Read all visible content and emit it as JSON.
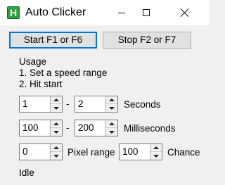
{
  "window": {
    "title": "Auto Clicker",
    "icon_letter": "H"
  },
  "buttons": {
    "start": "Start F1 or F6",
    "stop": "Stop F2 or F7"
  },
  "usage": {
    "heading": "Usage",
    "step1": "1. Set a speed range",
    "step2": "2. Hit start"
  },
  "seconds": {
    "min": "1",
    "separator": "-",
    "max": "2",
    "unit": "Seconds"
  },
  "milliseconds": {
    "min": "100",
    "separator": "-",
    "max": "200",
    "unit": "Milliseconds"
  },
  "pixel": {
    "range": "0",
    "range_label": "Pixel range",
    "chance": "100",
    "chance_label": "Chance"
  },
  "status": "Idle",
  "colors": {
    "focus_border": "#0078d7",
    "icon_green": "#2e9e3e"
  }
}
